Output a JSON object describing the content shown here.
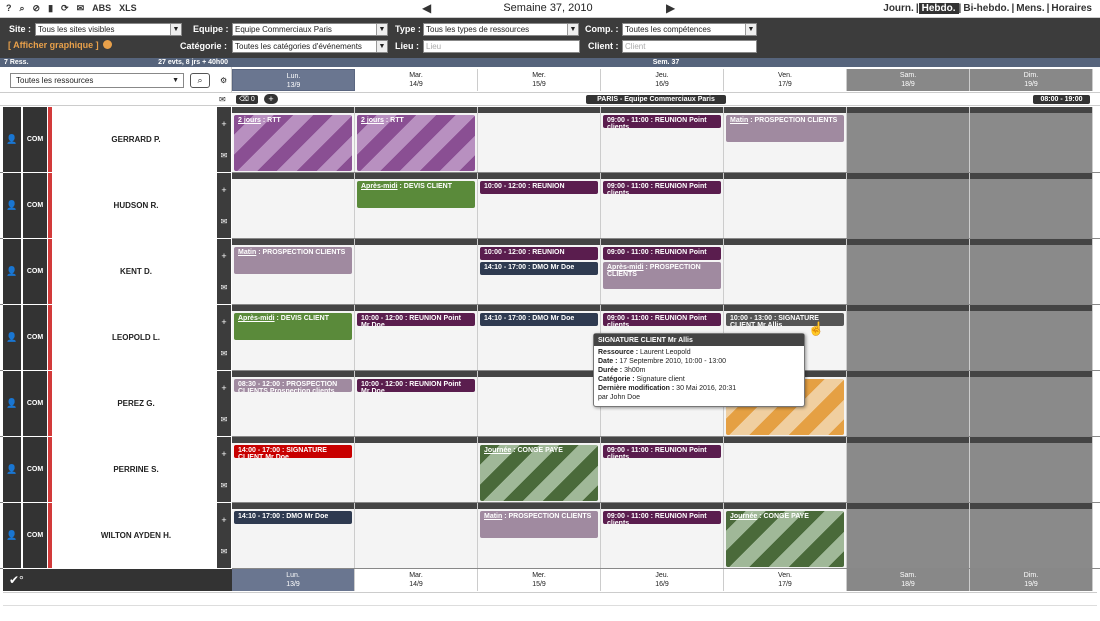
{
  "toolbar": {
    "icons": [
      "?",
      "⌕",
      "⊘",
      "▮",
      "⟳",
      "✉"
    ],
    "abs": "ABS",
    "xls": "XLS"
  },
  "week": {
    "title": "Semaine 37, 2010",
    "prev": "◀",
    "next": "▶"
  },
  "views": {
    "journ": "Journ.",
    "hebdo": "Hebdo.",
    "bihebdo": "Bi-hebdo.",
    "mens": "Mens.",
    "horaires": "Horaires"
  },
  "filters": {
    "site_label": "Site :",
    "site_value": "Tous les sites visibles",
    "equipe_label": "Equipe :",
    "equipe_value": "Equipe Commerciaux Paris",
    "type_label": "Type :",
    "type_value": "Tous les types de ressources",
    "comp_label": "Comp. :",
    "comp_value": "Toutes les compétences",
    "categorie_label": "Catégorie :",
    "categorie_value": "Toutes les catégories d'événements",
    "lieu_label": "Lieu :",
    "lieu_placeholder": "Lieu",
    "client_label": "Client :",
    "client_placeholder": "Client",
    "graph_label": "[ Afficher graphique ]"
  },
  "summary": {
    "left": "7 Ress.",
    "right": "27 evts, 8 jrs + 40h00",
    "sem": "Sem. 37"
  },
  "resources_select": "Toutes les ressources",
  "group": {
    "count": "0",
    "team": "PARIS - Equipe Commerciaux Paris",
    "hours": "08:00 - 19:00"
  },
  "days": [
    {
      "name": "Lun.",
      "date": "13/9",
      "type": "sel"
    },
    {
      "name": "Mar.",
      "date": "14/9",
      "type": ""
    },
    {
      "name": "Mer.",
      "date": "15/9",
      "type": ""
    },
    {
      "name": "Jeu.",
      "date": "16/9",
      "type": ""
    },
    {
      "name": "Ven.",
      "date": "17/9",
      "type": ""
    },
    {
      "name": "Sam.",
      "date": "18/9",
      "type": "we"
    },
    {
      "name": "Dim.",
      "date": "19/9",
      "type": "we"
    }
  ],
  "rows": [
    {
      "name": "GERRARD P.",
      "role": "COM",
      "events": [
        {
          "day": 0,
          "slot": 0,
          "tall": true,
          "link": "2 jours",
          "text": " : RTT",
          "color": "#8a4f93",
          "stripes": "#b890c0"
        },
        {
          "day": 1,
          "slot": 0,
          "tall": true,
          "link": "2 jours",
          "text": " : RTT",
          "color": "#8a4f93",
          "stripes": "#b890c0"
        },
        {
          "day": 3,
          "slot": 0,
          "link": "",
          "text": "09:00 - 11:00 : REUNION Point clients",
          "color": "#5a1d4e"
        },
        {
          "day": 4,
          "slot": 0,
          "med": true,
          "link": "Matin",
          "text": " : PROSPECTION CLIENTS",
          "color": "#a08aa0"
        }
      ]
    },
    {
      "name": "HUDSON R.",
      "role": "COM",
      "events": [
        {
          "day": 1,
          "slot": 0,
          "med": true,
          "link": "Après-midi",
          "text": " : DEVIS CLIENT",
          "color": "#5a8a3a"
        },
        {
          "day": 2,
          "slot": 0,
          "link": "",
          "text": "10:00 - 12:00 : REUNION",
          "color": "#5a1d4e"
        },
        {
          "day": 3,
          "slot": 0,
          "link": "",
          "text": "09:00 - 11:00 : REUNION Point clients",
          "color": "#5a1d4e"
        }
      ]
    },
    {
      "name": "KENT D.",
      "role": "COM",
      "events": [
        {
          "day": 0,
          "slot": 0,
          "med": true,
          "link": "Matin",
          "text": " : PROSPECTION CLIENTS",
          "color": "#a08aa0"
        },
        {
          "day": 2,
          "slot": 0,
          "link": "",
          "text": "10:00 - 12:00 : REUNION",
          "color": "#5a1d4e"
        },
        {
          "day": 2,
          "slot": 1,
          "link": "",
          "text": "14:10 - 17:00 : DMO Mr Doe",
          "color": "#2e3a50"
        },
        {
          "day": 3,
          "slot": 0,
          "link": "",
          "text": "09:00 - 11:00 : REUNION Point",
          "color": "#5a1d4e"
        },
        {
          "day": 3,
          "slot": 1,
          "med": true,
          "link": "Après-midi",
          "text": " : PROSPECTION CLIENTS",
          "color": "#a08aa0"
        }
      ]
    },
    {
      "name": "LEOPOLD L.",
      "role": "COM",
      "events": [
        {
          "day": 0,
          "slot": 0,
          "med": true,
          "link": "Après-midi",
          "text": " : DEVIS CLIENT",
          "color": "#5a8a3a"
        },
        {
          "day": 1,
          "slot": 0,
          "link": "",
          "text": "10:00 - 12:00 : REUNION Point Mr Doe",
          "color": "#5a1d4e"
        },
        {
          "day": 2,
          "slot": 0,
          "link": "",
          "text": "14:10 - 17:00 : DMO Mr Doe",
          "color": "#2e3a50"
        },
        {
          "day": 3,
          "slot": 0,
          "link": "",
          "text": "09:00 - 11:00 : REUNION Point clients",
          "color": "#5a1d4e"
        },
        {
          "day": 4,
          "slot": 0,
          "link": "",
          "text": "10:00 - 13:00 : SIGNATURE CLIENT Mr Allis",
          "color": "#555"
        }
      ]
    },
    {
      "name": "PEREZ G.",
      "role": "COM",
      "events": [
        {
          "day": 0,
          "slot": 0,
          "link": "",
          "text": "08:30 - 12:00 : PROSPECTION CLIENTS Prospection clients",
          "color": "#a08aa0"
        },
        {
          "day": 1,
          "slot": 0,
          "link": "",
          "text": "10:00 - 12:00 : REUNION Point Mr Doe",
          "color": "#5a1d4e"
        },
        {
          "day": 4,
          "slot": 0,
          "tall": true,
          "link": "",
          "text": "ADIE",
          "color": "#e5a043",
          "stripes": "#f0cfa0"
        }
      ]
    },
    {
      "name": "PERRINE S.",
      "role": "COM",
      "events": [
        {
          "day": 0,
          "slot": 0,
          "link": "",
          "text": "14:00 - 17:00 : SIGNATURE CLIENT Mr Doe",
          "color": "#c80000"
        },
        {
          "day": 2,
          "slot": 0,
          "tall": true,
          "link": "Journée",
          "text": " : CONGE PAYE",
          "color": "#4a6a3a",
          "stripes": "#a0b898"
        },
        {
          "day": 3,
          "slot": 0,
          "link": "",
          "text": "09:00 - 11:00 : REUNION Point clients",
          "color": "#5a1d4e"
        }
      ]
    },
    {
      "name": "WILTON AYDEN H.",
      "role": "COM",
      "events": [
        {
          "day": 0,
          "slot": 0,
          "link": "",
          "text": "14:10 - 17:00 : DMO Mr Doe",
          "color": "#2e3a50"
        },
        {
          "day": 2,
          "slot": 0,
          "med": true,
          "link": "Matin",
          "text": " : PROSPECTION CLIENTS",
          "color": "#a08aa0"
        },
        {
          "day": 3,
          "slot": 0,
          "link": "",
          "text": "09:00 - 11:00 : REUNION Point clients",
          "color": "#5a1d4e"
        },
        {
          "day": 4,
          "slot": 0,
          "tall": true,
          "link": "Journée",
          "text": " : CONGE PAYE",
          "color": "#4a6a3a",
          "stripes": "#a0b898"
        }
      ]
    }
  ],
  "tooltip": {
    "title": "SIGNATURE CLIENT Mr Allis",
    "ressource_l": "Ressource :",
    "ressource_v": " Laurent Leopold",
    "date_l": "Date :",
    "date_v": " 17 Septembre 2010, 10:00 - 13:00",
    "duree_l": "Durée :",
    "duree_v": " 3h00m",
    "categorie_l": "Catégorie :",
    "categorie_v": " Signature client",
    "modif_l": "Dernière modification :",
    "modif_v": " 30 Mai 2016, 20:31",
    "by": "par John Doe"
  },
  "bottom": {
    "check": "✔°"
  }
}
